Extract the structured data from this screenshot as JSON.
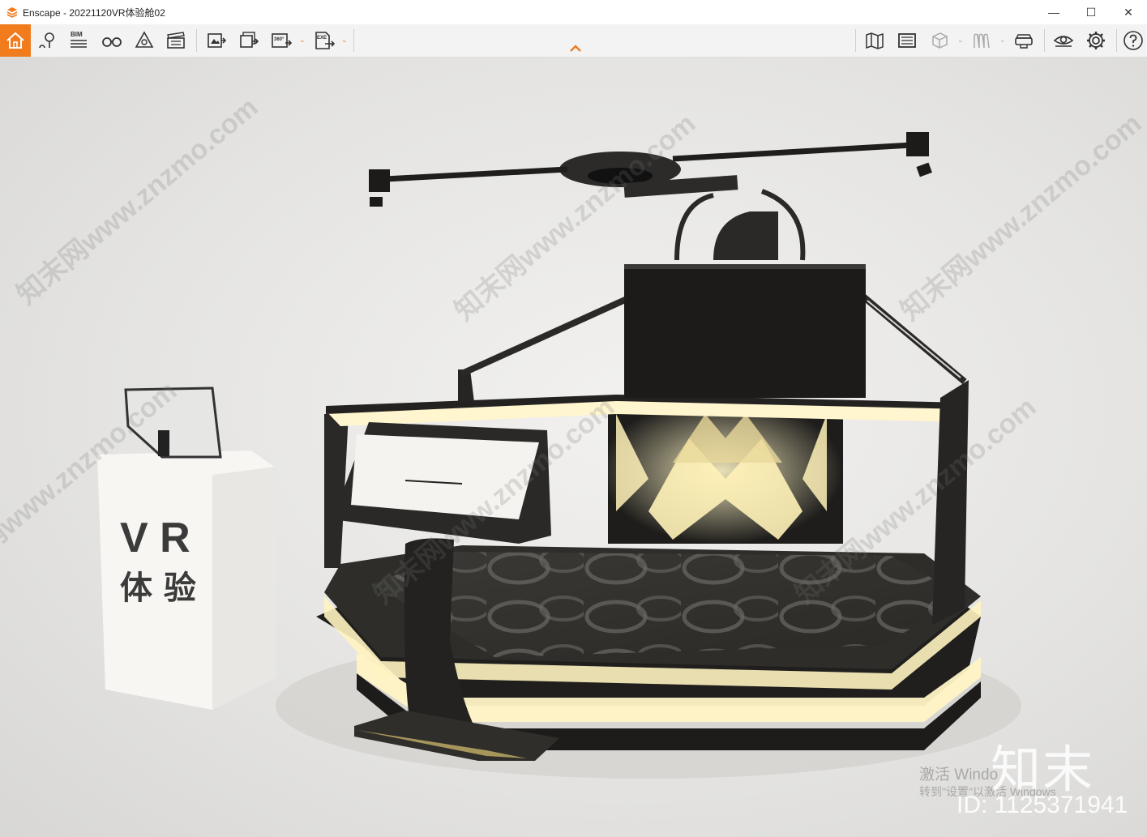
{
  "window": {
    "title": "Enscape - 20221120VR体验舱02",
    "controls": {
      "minimize": "—",
      "maximize": "☐",
      "close": "✕"
    }
  },
  "toolbar": {
    "bim_label": "BIM",
    "pano_label": "360°",
    "exe_label": "EXE",
    "accent_color": "#f07c1e"
  },
  "scene": {
    "kiosk_text_line1": "V R",
    "kiosk_text_line2": "体 验"
  },
  "watermark": {
    "text": "知末网www.znzmo.com"
  },
  "windows_activation": {
    "line1": "激活 Windo",
    "line2": "转到\"设置\"以激活 Windows"
  },
  "brand": {
    "logo_text": "知末",
    "id_text": "ID: 1125371941"
  }
}
